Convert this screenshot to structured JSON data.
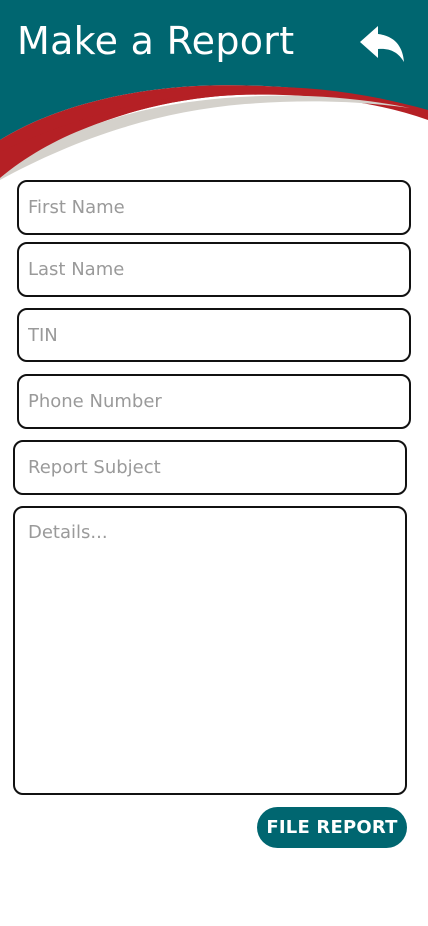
{
  "header": {
    "title": "Make a Report",
    "back_icon": "reply-arrow-icon"
  },
  "colors": {
    "primary": "#006670",
    "accent_red": "#B52025",
    "accent_gray": "#D4D1CB",
    "background": "#FFFFFF"
  },
  "form": {
    "first_name": {
      "value": "",
      "placeholder": "First Name"
    },
    "last_name": {
      "value": "",
      "placeholder": "Last Name"
    },
    "tin": {
      "value": "",
      "placeholder": "TIN"
    },
    "phone": {
      "value": "",
      "placeholder": "Phone Number"
    },
    "subject": {
      "value": "",
      "placeholder": "Report Subject"
    },
    "details": {
      "value": "",
      "placeholder": "Details..."
    },
    "submit_label": "FILE REPORT"
  }
}
